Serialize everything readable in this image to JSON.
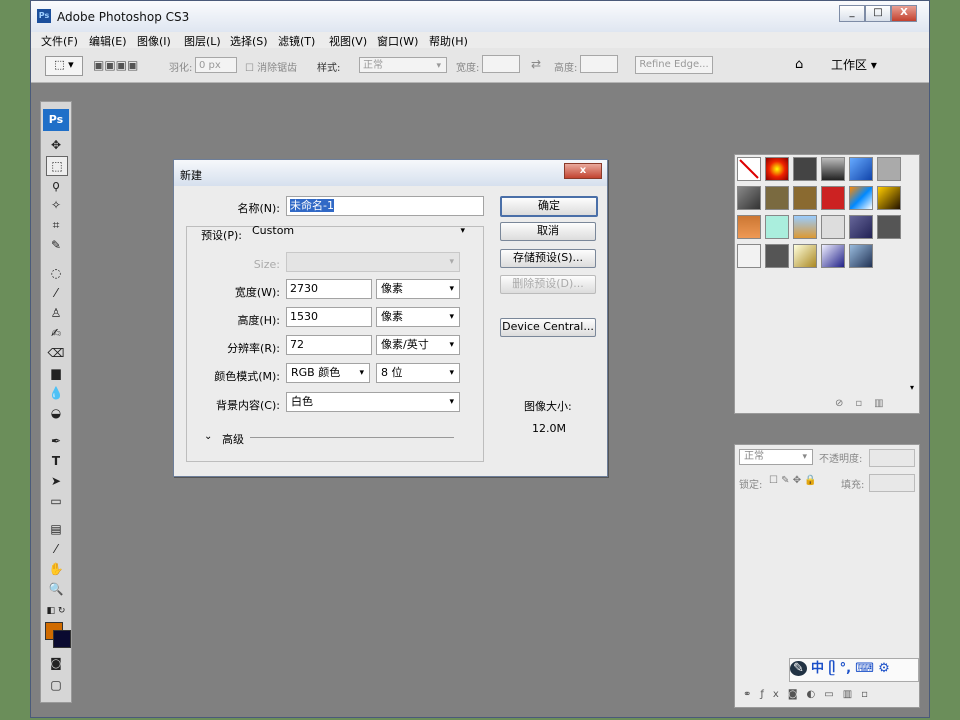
{
  "window": {
    "title": "Adobe Photoshop CS3",
    "icon": "Ps",
    "min": "_",
    "max": "□",
    "close": "X"
  },
  "menu": [
    "文件(F)",
    "编辑(E)",
    "图像(I)",
    "图层(L)",
    "选择(S)",
    "滤镜(T)",
    "视图(V)",
    "窗口(W)",
    "帮助(H)"
  ],
  "options": {
    "feather_label": "羽化:",
    "feather_value": "0 px",
    "antialias_label": "消除锯齿",
    "style_label": "样式:",
    "style_value": "正常",
    "width_label": "宽度:",
    "height_label": "高度:",
    "refine_edge": "Refine Edge...",
    "workspace": "工作区 ▾"
  },
  "toolbox": {
    "logo": "Ps"
  },
  "dialog": {
    "title": "新建",
    "close": "x",
    "name_label": "名称(N):",
    "name_value": "未命名-1",
    "preset_label": "预设(P):",
    "preset_value": "Custom",
    "size_label": "Size:",
    "width_label": "宽度(W):",
    "width_value": "2730",
    "width_unit": "像素",
    "height_label": "高度(H):",
    "height_value": "1530",
    "height_unit": "像素",
    "resolution_label": "分辨率(R):",
    "resolution_value": "72",
    "resolution_unit": "像素/英寸",
    "mode_label": "颜色模式(M):",
    "mode_value": "RGB 颜色",
    "bit_value": "8 位",
    "bg_label": "背景内容(C):",
    "bg_value": "白色",
    "advanced_label": "高级",
    "ok": "确定",
    "cancel": "取消",
    "save_preset": "存储预设(S)...",
    "delete_preset": "删除预设(D)...",
    "device_central": "Device Central...",
    "image_size_label": "图像大小:",
    "image_size_value": "12.0M"
  },
  "layers": {
    "blend": "正常",
    "opacity_label": "不透明度:",
    "lock_label": "锁定:",
    "fill_label": "填充:"
  },
  "ime": {
    "chars": "中 ᥫ °,"
  },
  "colors": {
    "foreground": "#d06b00",
    "background": "#0a0a30",
    "workspace": "#808080"
  }
}
